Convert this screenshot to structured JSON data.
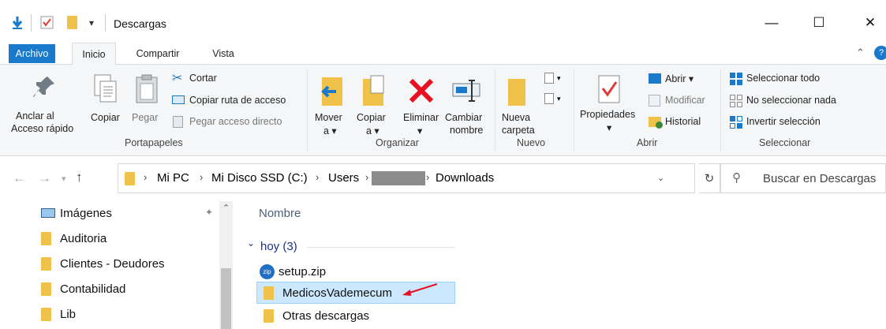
{
  "window": {
    "title": "Descargas",
    "minimize": "—",
    "maximize": "☐",
    "close": "✕"
  },
  "tabs": [
    "Archivo",
    "Inicio",
    "Compartir",
    "Vista"
  ],
  "ribbon": {
    "portapapeles": {
      "anclar": [
        "Anclar al",
        "Acceso rápido"
      ],
      "copiar": "Copiar",
      "pegar": "Pegar",
      "cortar": "Cortar",
      "copiar_ruta": "Copiar ruta de acceso",
      "pegar_acceso": "Pegar acceso directo",
      "group": "Portapapeles"
    },
    "organizar": {
      "mover": [
        "Mover",
        "a ▾"
      ],
      "copiar": [
        "Copiar",
        "a ▾"
      ],
      "eliminar": [
        "Eliminar",
        "▾"
      ],
      "cambiar": [
        "Cambiar",
        "nombre"
      ],
      "group": "Organizar"
    },
    "nuevo": {
      "nueva": [
        "Nueva",
        "carpeta"
      ],
      "group": "Nuevo"
    },
    "abrir": {
      "propiedades": [
        "Propiedades",
        "▾"
      ],
      "abrir": "Abrir ▾",
      "modificar": "Modificar",
      "historial": "Historial",
      "group": "Abrir"
    },
    "seleccionar": {
      "todo": "Seleccionar todo",
      "nada": "No seleccionar nada",
      "invertir": "Invertir selección",
      "group": "Seleccionar"
    }
  },
  "address": {
    "crumbs": [
      "Mi PC",
      "Mi Disco SSD (C:)",
      "Users",
      "Downloads"
    ],
    "search_placeholder": "Buscar en Descargas"
  },
  "nav": [
    "Imágenes",
    "Auditoria",
    "Clientes - Deudores",
    "Contabilidad",
    "Lib"
  ],
  "list": {
    "column": "Nombre",
    "group": "hoy (3)",
    "files": [
      "setup.zip",
      "MedicosVademecum",
      "Otras descargas"
    ]
  },
  "colors": {
    "accent": "#1979ca",
    "selection": "#cce8ff",
    "folder": "#f0c24a",
    "arrow": "#e81123"
  }
}
